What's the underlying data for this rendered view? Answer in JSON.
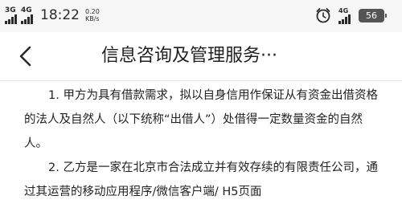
{
  "status_bar": {
    "sim1_label": "3G",
    "sim2_label": "4G",
    "time": "18:22",
    "net_speed_value": "0.20",
    "net_speed_unit": "KB/s",
    "right_signal_label": "4G",
    "battery_level": "56",
    "icons": {
      "alarm": "alarm-clock-icon",
      "signal": "signal-bars-icon"
    }
  },
  "nav": {
    "back_icon": "chevron-left-icon",
    "title": "信息咨询及管理服务···"
  },
  "content": {
    "paragraphs": [
      "1. 甲方为具有借款需求，拟以自身信用作保证从有资金出借资格的法人及自然人（以下统称“出借人”）处借得一定数量资金的自然人。",
      "2. 乙方是一家在北京市合法成立并有效存续的有限责任公司，通过其运营的移动应用程序/微信客户端/ H5页面"
    ]
  },
  "colors": {
    "status_bar_bg": "#f6f6f6",
    "text": "#222222",
    "divider": "#e4e4e4"
  }
}
